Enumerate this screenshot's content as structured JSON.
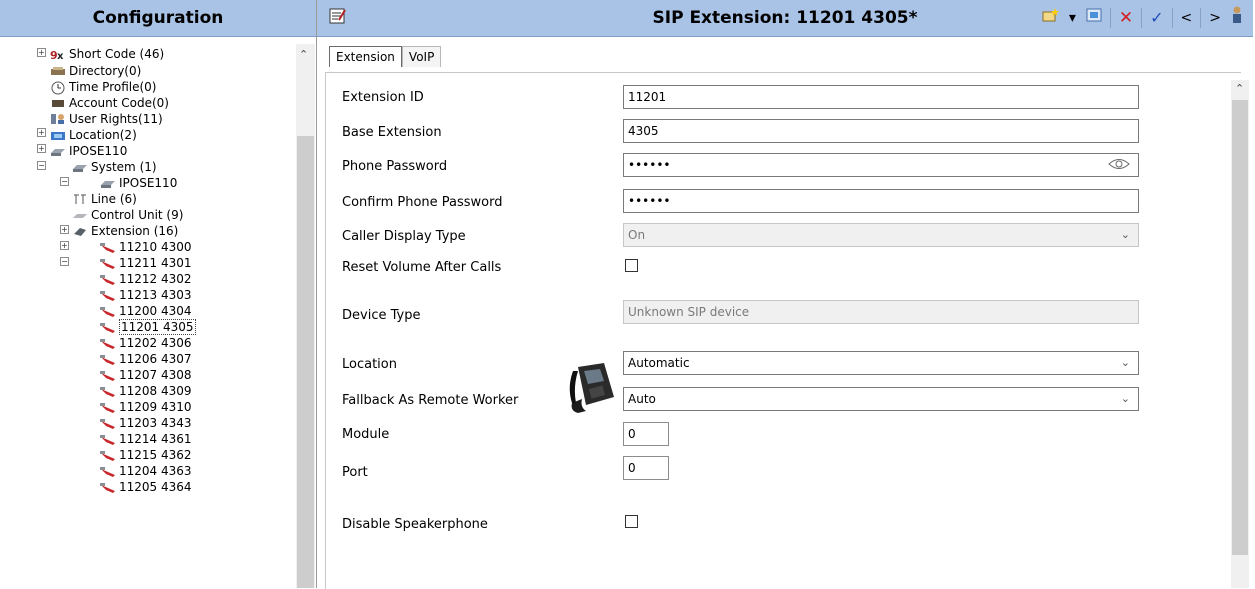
{
  "left_panel": {
    "title": "Configuration",
    "tree": [
      {
        "label": "Short Code (46)",
        "icon": "short-code-icon"
      },
      {
        "label": "Directory(0)",
        "icon": "directory-icon"
      },
      {
        "label": "Time Profile(0)",
        "icon": "clock-icon"
      },
      {
        "label": "Account Code(0)",
        "icon": "account-code-icon"
      },
      {
        "label": "User Rights(11)",
        "icon": "user-rights-icon"
      },
      {
        "label": "Location(2)",
        "icon": "location-icon"
      },
      {
        "label": "IPOSE110",
        "icon": "server-icon"
      },
      {
        "label": "System (1)",
        "icon": "system-icon"
      },
      {
        "label": "IPOSE110",
        "icon": "system-icon"
      },
      {
        "label": "Line (6)",
        "icon": "line-icon"
      },
      {
        "label": "Control Unit (9)",
        "icon": "control-unit-icon"
      },
      {
        "label": "Extension (16)",
        "icon": "extension-icon"
      },
      {
        "label": "11210 4300",
        "icon": "sip-extension-icon"
      },
      {
        "label": "11211 4301",
        "icon": "sip-extension-icon"
      },
      {
        "label": "11212 4302",
        "icon": "sip-extension-icon"
      },
      {
        "label": "11213 4303",
        "icon": "sip-extension-icon"
      },
      {
        "label": "11200 4304",
        "icon": "sip-extension-icon"
      },
      {
        "label": "11201 4305",
        "icon": "sip-extension-icon"
      },
      {
        "label": "11202 4306",
        "icon": "sip-extension-icon"
      },
      {
        "label": "11206 4307",
        "icon": "sip-extension-icon"
      },
      {
        "label": "11207 4308",
        "icon": "sip-extension-icon"
      },
      {
        "label": "11208 4309",
        "icon": "sip-extension-icon"
      },
      {
        "label": "11209 4310",
        "icon": "sip-extension-icon"
      },
      {
        "label": "11203 4343",
        "icon": "sip-extension-icon"
      },
      {
        "label": "11214 4361",
        "icon": "sip-extension-icon"
      },
      {
        "label": "11215 4362",
        "icon": "sip-extension-icon"
      },
      {
        "label": "11204 4363",
        "icon": "sip-extension-icon"
      },
      {
        "label": "11205 4364",
        "icon": "sip-extension-icon"
      }
    ]
  },
  "editor": {
    "title": "SIP Extension: 11201 4305*",
    "tabs": [
      {
        "label": "Extension"
      },
      {
        "label": "VoIP"
      }
    ],
    "fields": {
      "extension_id": {
        "label": "Extension ID",
        "value": "11201"
      },
      "base_extension": {
        "label": "Base Extension",
        "value": "4305"
      },
      "phone_password": {
        "label": "Phone Password",
        "value": "••••••"
      },
      "confirm_phone_password": {
        "label": "Confirm Phone Password",
        "value": "••••••"
      },
      "caller_display_type": {
        "label": "Caller Display Type",
        "value": "On"
      },
      "reset_volume": {
        "label": "Reset Volume After Calls",
        "checked": false
      },
      "device_type": {
        "label": "Device Type",
        "value": "Unknown SIP device"
      },
      "location": {
        "label": "Location",
        "value": "Automatic"
      },
      "fallback_remote_worker": {
        "label": "Fallback As Remote Worker",
        "value": "Auto"
      },
      "module": {
        "label": "Module",
        "value": "0"
      },
      "port": {
        "label": "Port",
        "value": "0"
      },
      "disable_speakerphone": {
        "label": "Disable Speakerphone",
        "checked": false
      }
    }
  },
  "colors": {
    "header_bg": "#a9c3e6",
    "delete_red": "#d21f1f",
    "check_blue": "#1f4fb8",
    "extension_icon_red": "#c8282d"
  }
}
